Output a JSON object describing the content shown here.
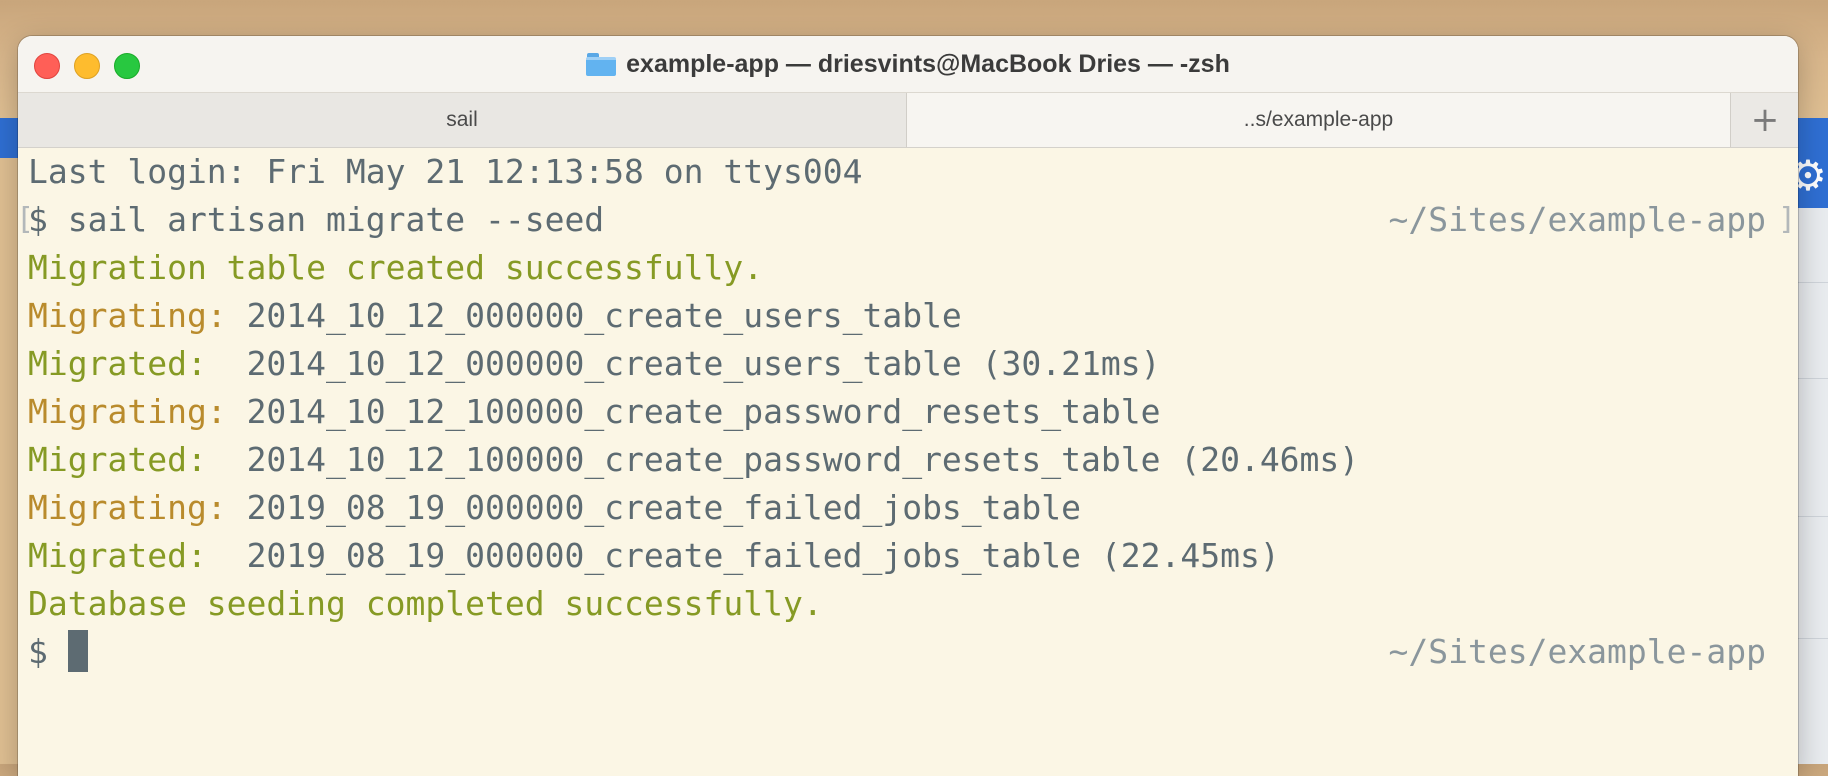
{
  "window": {
    "title": "example-app — driesvints@MacBook Dries — -zsh"
  },
  "tabs": [
    {
      "label": "sail"
    },
    {
      "label": "..s/example-app"
    }
  ],
  "tab_add_label": "+",
  "terminal": {
    "last_login": "Last login: Fri May 21 12:13:58 on ttys004",
    "prompt_symbol": "$",
    "command": "sail artisan migrate --seed",
    "cwd": "~/Sites/example-app",
    "bracket_left": "[",
    "bracket_right": "]",
    "output": [
      {
        "label": "Migration table created successfully.",
        "text": ""
      },
      {
        "label": "Migrating:",
        "text": "2014_10_12_000000_create_users_table"
      },
      {
        "label": "Migrated: ",
        "text": "2014_10_12_000000_create_users_table (30.21ms)"
      },
      {
        "label": "Migrating:",
        "text": "2014_10_12_100000_create_password_resets_table"
      },
      {
        "label": "Migrated: ",
        "text": "2014_10_12_100000_create_password_resets_table (20.46ms)"
      },
      {
        "label": "Migrating:",
        "text": "2019_08_19_000000_create_failed_jobs_table"
      },
      {
        "label": "Migrated: ",
        "text": "2019_08_19_000000_create_failed_jobs_table (22.45ms)"
      },
      {
        "label": "Database seeding completed successfully.",
        "text": ""
      }
    ]
  },
  "colors": {
    "success_green": "#869a24",
    "migrating_yellow": "#b98b2c",
    "text_gray": "#5d6b72",
    "terminal_bg": "#fbf6e5"
  }
}
